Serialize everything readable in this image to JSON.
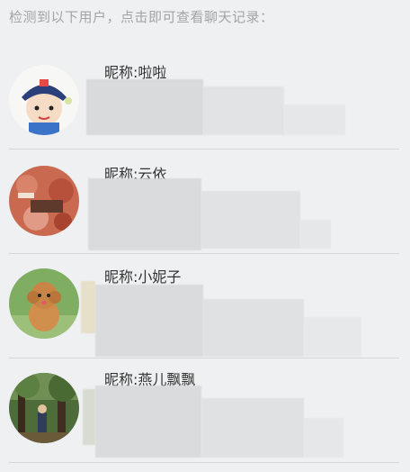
{
  "header": {
    "text": "检测到以下用户，点击即可查看聊天记录："
  },
  "users": [
    {
      "nickname": "昵称:啦啦",
      "avatar_icon": "cartoon-boy-avatar"
    },
    {
      "nickname": "昵称:云依",
      "avatar_icon": "red-flowers-avatar"
    },
    {
      "nickname": "昵称:小妮子",
      "avatar_icon": "poodle-dog-avatar"
    },
    {
      "nickname": "昵称:燕儿飘飘",
      "avatar_icon": "forest-photo-avatar"
    }
  ]
}
